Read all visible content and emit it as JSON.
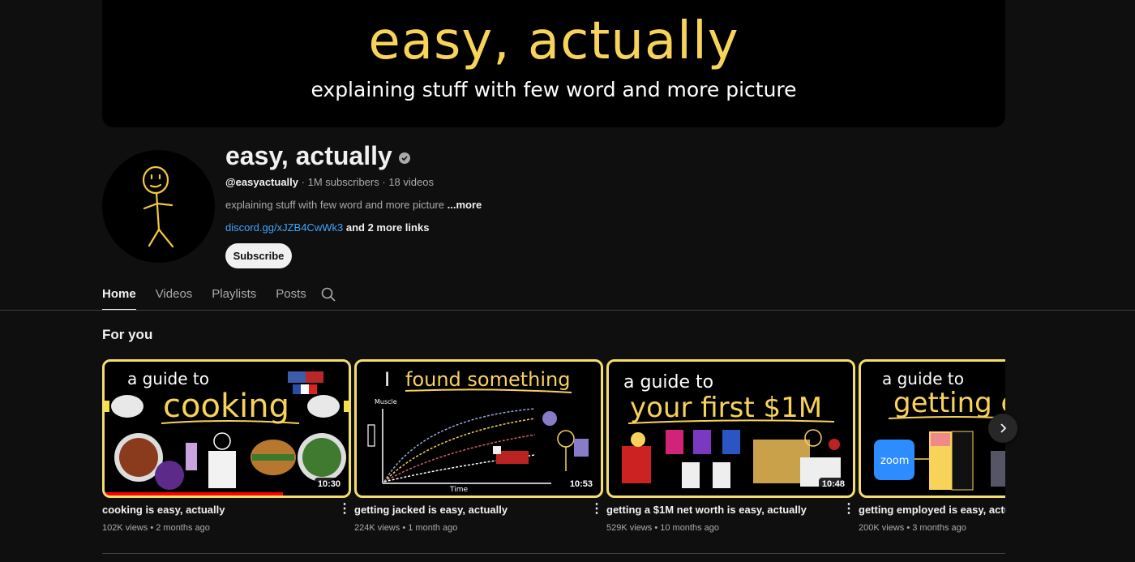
{
  "banner": {
    "title": "easy, actually",
    "subtitle": "explaining stuff with few word and more picture"
  },
  "channel": {
    "name": "easy, actually",
    "handle": "@easyactually",
    "subscribers": "1M subscribers",
    "videos": "18 videos",
    "description": "explaining stuff with few word and more picture",
    "more": "...more",
    "link": "discord.gg/xJZB4CwWk3",
    "more_links": "and 2 more links",
    "subscribe_label": "Subscribe"
  },
  "tabs": [
    {
      "label": "Home",
      "active": true
    },
    {
      "label": "Videos"
    },
    {
      "label": "Playlists"
    },
    {
      "label": "Posts"
    }
  ],
  "section": {
    "title": "For you"
  },
  "videos": [
    {
      "title": "cooking is easy, actually",
      "views": "102K views",
      "age": "2 months ago",
      "duration": "10:30",
      "watched_fraction": 0.73,
      "thumb_top": "a guide to",
      "thumb_big": "cooking"
    },
    {
      "title": "getting jacked is easy, actually",
      "views": "224K views",
      "age": "1 month ago",
      "duration": "10:53",
      "thumb_top": "I found something",
      "thumb_axis_y": "Muscle",
      "thumb_axis_x": "Time"
    },
    {
      "title": "getting a $1M net worth is easy, actually",
      "views": "529K views",
      "age": "10 months ago",
      "duration": "10:48",
      "thumb_top": "a guide to",
      "thumb_big": "your first $1M"
    },
    {
      "title": "getting employed is easy, actually",
      "views": "200K views",
      "age": "3 months ago",
      "thumb_top": "a guide to",
      "thumb_big": "getting e",
      "thumb_logo": "zoom"
    }
  ],
  "colors": {
    "accent_yellow": "#f7d35a",
    "link_blue": "#3ea6ff",
    "background": "#0f0f0f",
    "progress_red": "#ff0000"
  }
}
